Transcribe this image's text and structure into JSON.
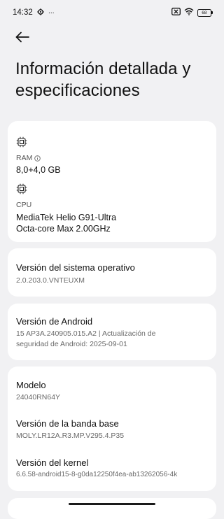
{
  "status_bar": {
    "time": "14:32",
    "more": "···",
    "battery_level": "68"
  },
  "header": {
    "title": "Información detallada y especificaciones"
  },
  "hardware": {
    "ram_label": "RAM",
    "ram_value": "8,0+4,0 GB",
    "cpu_label": "CPU",
    "cpu_value_line1": "MediaTek Helio G91-Ultra",
    "cpu_value_line2": "Octa-core Max 2.00GHz"
  },
  "os_version": {
    "title": "Versión del sistema operativo",
    "value": "2.0.203.0.VNTEUXM"
  },
  "android_version": {
    "title": "Versión de Android",
    "value_line1": "15 AP3A.240905.015.A2 | Actualización de",
    "value_line2": "seguridad de Android: 2025-09-01"
  },
  "device": {
    "model_title": "Modelo",
    "model_value": "24040RN64Y",
    "baseband_title": "Versión de la banda base",
    "baseband_value": "MOLY.LR12A.R3.MP.V295.4.P35",
    "kernel_title": "Versión del kernel",
    "kernel_value": "6.6.58-android15-8-g0da12250f4ea-ab13262056-4k"
  },
  "colors": {
    "background": "#f1f1f3",
    "card": "#ffffff",
    "text_primary": "#111111",
    "text_secondary": "#6a6a6a"
  }
}
